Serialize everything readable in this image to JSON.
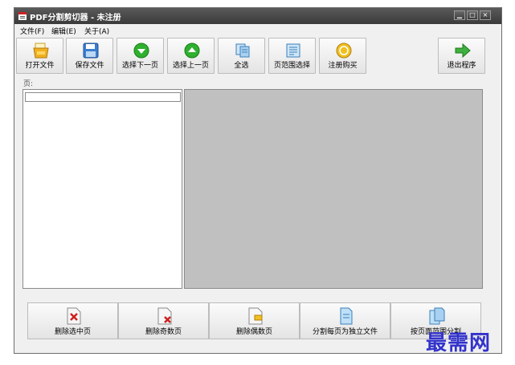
{
  "window": {
    "title": "PDF分割剪切器 - 未注册"
  },
  "title_controls": {
    "minimize": "▁",
    "maximize": "□",
    "close": "×"
  },
  "menu": [
    {
      "label": "文件(F)"
    },
    {
      "label": "编辑(E)"
    },
    {
      "label": "关于(A)"
    }
  ],
  "toolbar": {
    "open": {
      "label": "打开文件",
      "icon": "open-folder-icon"
    },
    "save": {
      "label": "保存文件",
      "icon": "floppy-disk-icon"
    },
    "next": {
      "label": "选择下一页",
      "icon": "arrow-down-circle-icon"
    },
    "prev": {
      "label": "选择上一页",
      "icon": "arrow-up-circle-icon"
    },
    "all": {
      "label": "全选",
      "icon": "select-all-icon"
    },
    "range": {
      "label": "页范围选择",
      "icon": "page-range-icon"
    },
    "register": {
      "label": "注册购买",
      "icon": "coin-icon"
    },
    "exit": {
      "label": "退出程序",
      "icon": "exit-arrow-icon"
    }
  },
  "page_panel": {
    "label": "页:",
    "input_value": ""
  },
  "actions": {
    "delete_selected": "删除选中页",
    "delete_odd": "删除奇数页",
    "delete_even": "删除偶数页",
    "split_each": "分割每页为独立文件",
    "split_by_range": "按页面范围分割"
  },
  "watermark": {
    "text": "最需网"
  },
  "colors": {
    "titlebar": "#3a3a3a",
    "preview_bg": "#c0c0c0",
    "watermark": "#3333cc"
  }
}
